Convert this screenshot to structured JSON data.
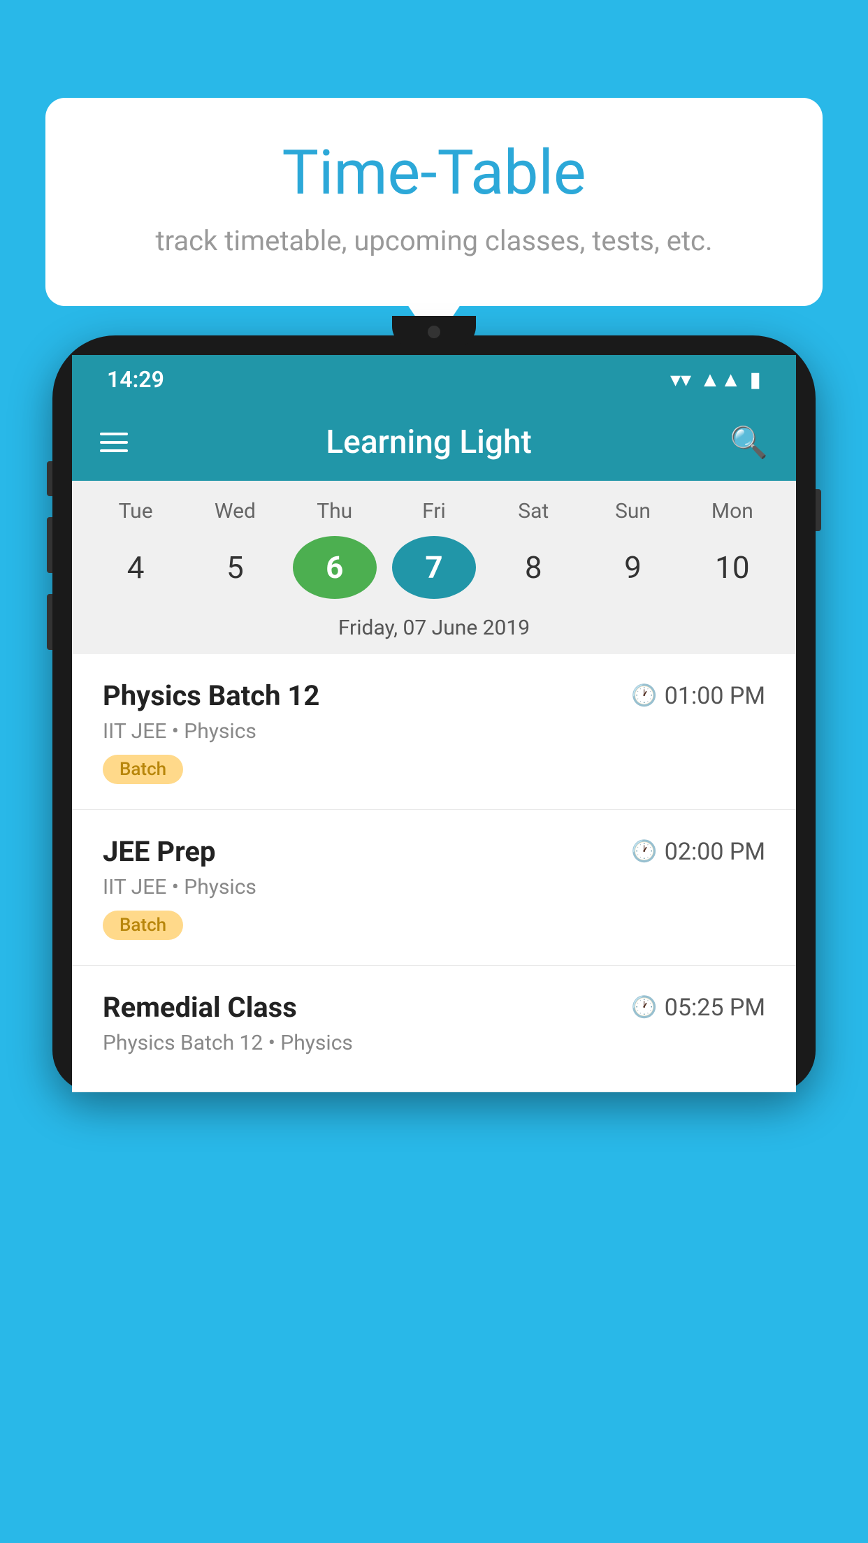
{
  "background_color": "#29b8e8",
  "bubble": {
    "title": "Time-Table",
    "subtitle": "track timetable, upcoming classes, tests, etc."
  },
  "status_bar": {
    "time": "14:29"
  },
  "app_bar": {
    "title": "Learning Light"
  },
  "calendar": {
    "selected_date_label": "Friday, 07 June 2019",
    "days": [
      {
        "name": "Tue",
        "number": "4",
        "state": "normal"
      },
      {
        "name": "Wed",
        "number": "5",
        "state": "normal"
      },
      {
        "name": "Thu",
        "number": "6",
        "state": "today"
      },
      {
        "name": "Fri",
        "number": "7",
        "state": "selected"
      },
      {
        "name": "Sat",
        "number": "8",
        "state": "normal"
      },
      {
        "name": "Sun",
        "number": "9",
        "state": "normal"
      },
      {
        "name": "Mon",
        "number": "10",
        "state": "normal"
      }
    ]
  },
  "schedule_items": [
    {
      "name": "Physics Batch 12",
      "time": "01:00 PM",
      "sub": "IIT JEE • Physics",
      "badge": "Batch"
    },
    {
      "name": "JEE Prep",
      "time": "02:00 PM",
      "sub": "IIT JEE • Physics",
      "badge": "Batch"
    },
    {
      "name": "Remedial Class",
      "time": "05:25 PM",
      "sub": "Physics Batch 12 • Physics",
      "badge": null
    }
  ],
  "labels": {
    "search_icon": "⌕",
    "clock_icon": "🕐",
    "battery_icon": "▮",
    "signal_icon": "▲"
  }
}
